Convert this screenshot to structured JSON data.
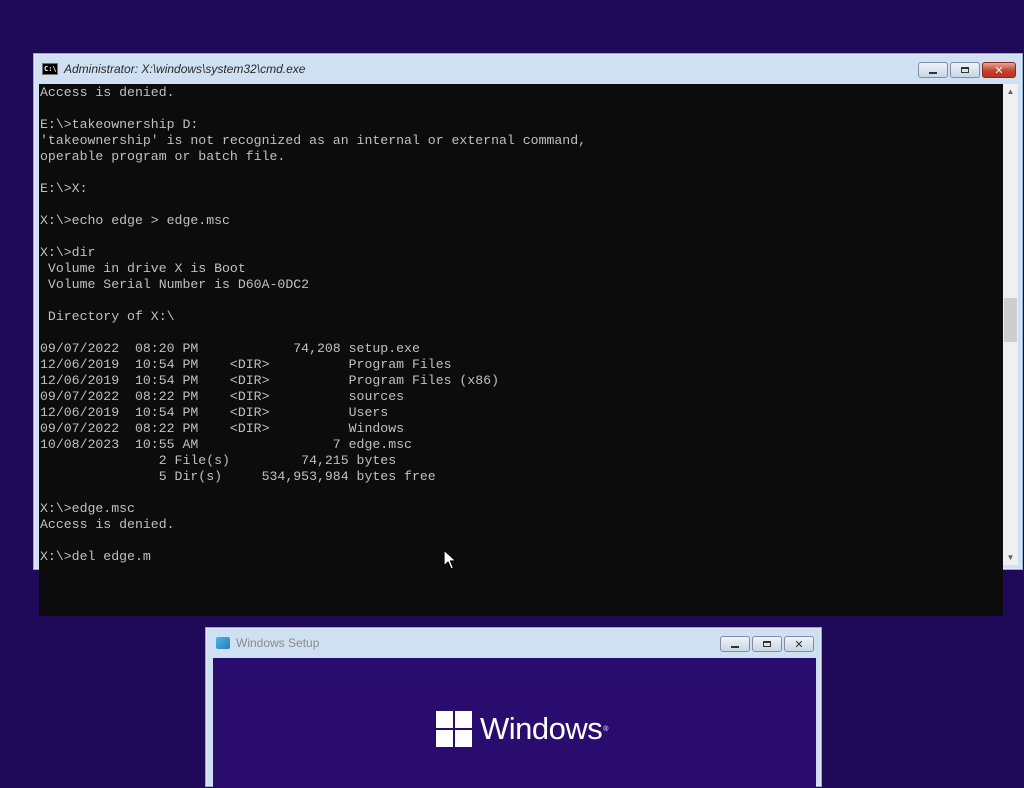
{
  "cmd_window": {
    "title": "Administrator: X:\\windows\\system32\\cmd.exe",
    "icon_text": "C:\\",
    "console_lines": [
      "Access is denied.",
      "",
      "E:\\>takeownership D:",
      "'takeownership' is not recognized as an internal or external command,",
      "operable program or batch file.",
      "",
      "E:\\>X:",
      "",
      "X:\\>echo edge > edge.msc",
      "",
      "X:\\>dir",
      " Volume in drive X is Boot",
      " Volume Serial Number is D60A-0DC2",
      "",
      " Directory of X:\\",
      "",
      "09/07/2022  08:20 PM            74,208 setup.exe",
      "12/06/2019  10:54 PM    <DIR>          Program Files",
      "12/06/2019  10:54 PM    <DIR>          Program Files (x86)",
      "09/07/2022  08:22 PM    <DIR>          sources",
      "12/06/2019  10:54 PM    <DIR>          Users",
      "09/07/2022  08:22 PM    <DIR>          Windows",
      "10/08/2023  10:55 AM                 7 edge.msc",
      "               2 File(s)         74,215 bytes",
      "               5 Dir(s)     534,953,984 bytes free",
      "",
      "X:\\>edge.msc",
      "Access is denied.",
      "",
      "X:\\>del edge.m"
    ],
    "caption_buttons": {
      "close": "✕"
    },
    "scrollbar": {
      "up_arrow": "▲",
      "down_arrow": "▼"
    }
  },
  "setup_window": {
    "title": "Windows Setup",
    "logo_text": "Windows",
    "logo_mark": "®",
    "caption_buttons": {
      "close": "✕"
    }
  },
  "colors": {
    "desktop": "#1f0a5a",
    "console_bg": "#0c0c0c",
    "console_text": "#c0c0c0",
    "setup_bg": "#2a0c6e"
  }
}
